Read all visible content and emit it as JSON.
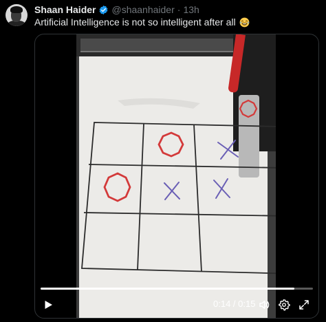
{
  "tweet": {
    "display_name": "Shaan Haider",
    "handle": "@shaanhaider",
    "separator": "·",
    "time": "13h",
    "text": "Artificial Intelligence is not so intelligent after all",
    "emoji": "face-with-tears-of-joy"
  },
  "video": {
    "current_time": "0:14",
    "duration": "0:15",
    "time_display": "0:14 / 0:15",
    "progress": 0.933
  },
  "colors": {
    "background": "#000000",
    "verified": "#1d9bf0",
    "muted_text": "#71767b",
    "o_marks": "#d33a3a",
    "x_marks": "#6a5fb5"
  },
  "board": {
    "cells": [
      [
        "",
        "O",
        "X"
      ],
      [
        "O",
        "X",
        "X"
      ],
      [
        "",
        "",
        ""
      ]
    ],
    "pending_mark": "O"
  }
}
